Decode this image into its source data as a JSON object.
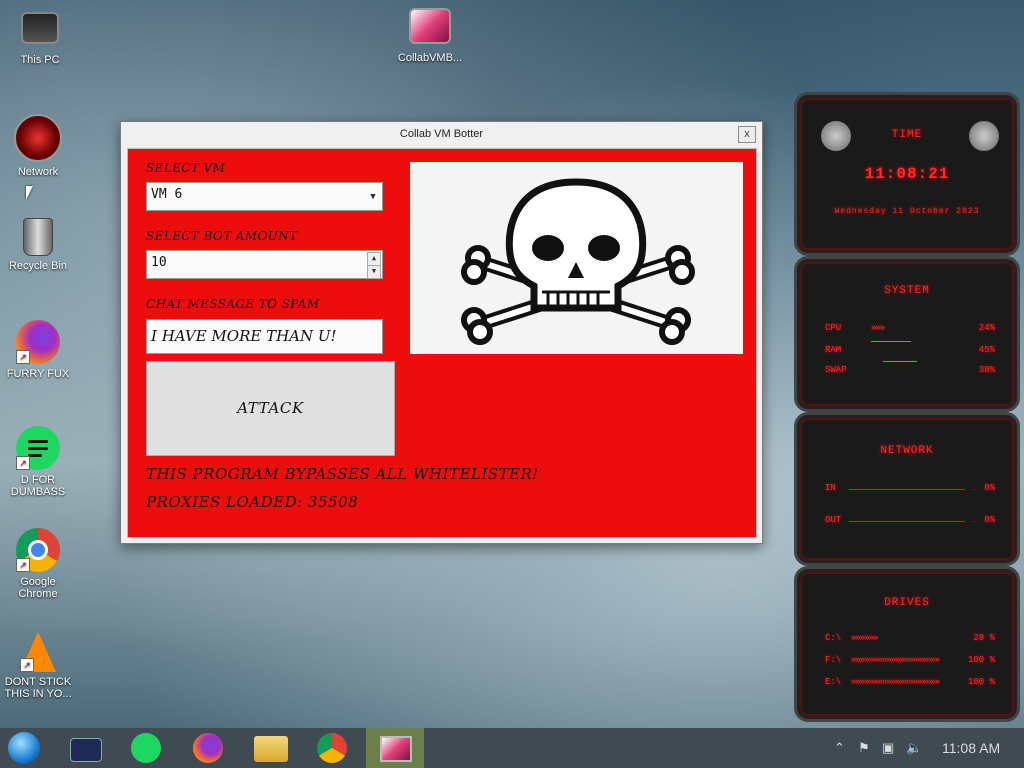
{
  "desktop": {
    "icons": [
      {
        "label": "This PC"
      },
      {
        "label": "Network"
      },
      {
        "label": "Recycle Bin"
      },
      {
        "label": "FURRY FUX"
      },
      {
        "label": "D FOR DUMBASS"
      },
      {
        "label": "Google Chrome"
      },
      {
        "label": "DONT STICK THIS IN YO..."
      },
      {
        "label": "CollabVMB..."
      }
    ]
  },
  "window": {
    "title": "Collab VM Botter",
    "close_glyph": "x",
    "select_vm_label": "SELECT VM",
    "select_vm_value": "VM 6",
    "bot_amount_label": "SELECT BOT AMOUNT",
    "bot_amount_value": "10",
    "chat_label": "CHAT MESSAGE TO SPAM",
    "chat_value": "I HAVE MORE THAN U!",
    "attack_label": "ATTACK",
    "bypass_text": "THIS PROGRAM BYPASSES ALL WHITELISTER!",
    "proxies_text": "PROXIES LOADED: 35508"
  },
  "gadget": {
    "time_title": "TIME",
    "time_value": "11:08:21",
    "date_value": "Wednesday 11 October 2023",
    "system_title": "SYSTEM",
    "cpu_label": "CPU",
    "cpu_value": "24%",
    "ram_label": "RAM",
    "ram_value": "45%",
    "swap_label": "SWAP",
    "swap_value": "38%",
    "network_title": "NETWORK",
    "in_label": "IN",
    "in_value": "0%",
    "out_label": "OUT",
    "out_value": "0%",
    "drives_title": "DRIVES",
    "drive_c_label": "C:\\",
    "drive_c_value": "28 %",
    "drive_f_label": "F:\\",
    "drive_f_value": "100 %",
    "drive_e_label": "E:\\",
    "drive_e_value": "100 %"
  },
  "taskbar": {
    "clock": "11:08 AM"
  },
  "colors": {
    "accent_red": "#ee0d0d",
    "gadget_red": "#ff2a2a",
    "taskbar": "#3f4a52"
  }
}
